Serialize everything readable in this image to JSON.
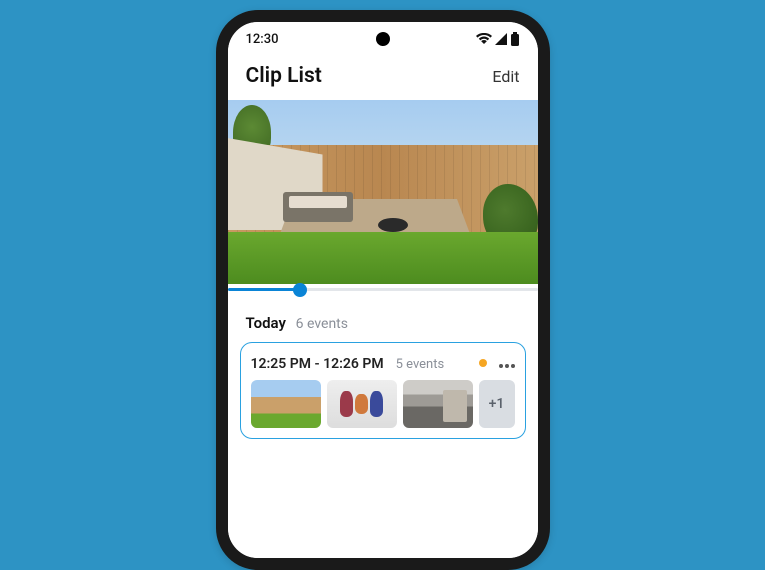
{
  "statusbar": {
    "time": "12:30"
  },
  "header": {
    "title": "Clip List",
    "edit": "Edit"
  },
  "day": {
    "label": "Today",
    "count": "6 events"
  },
  "card": {
    "time_range": "12:25 PM - 12:26 PM",
    "event_count": "5 events",
    "overflow": "+1"
  }
}
